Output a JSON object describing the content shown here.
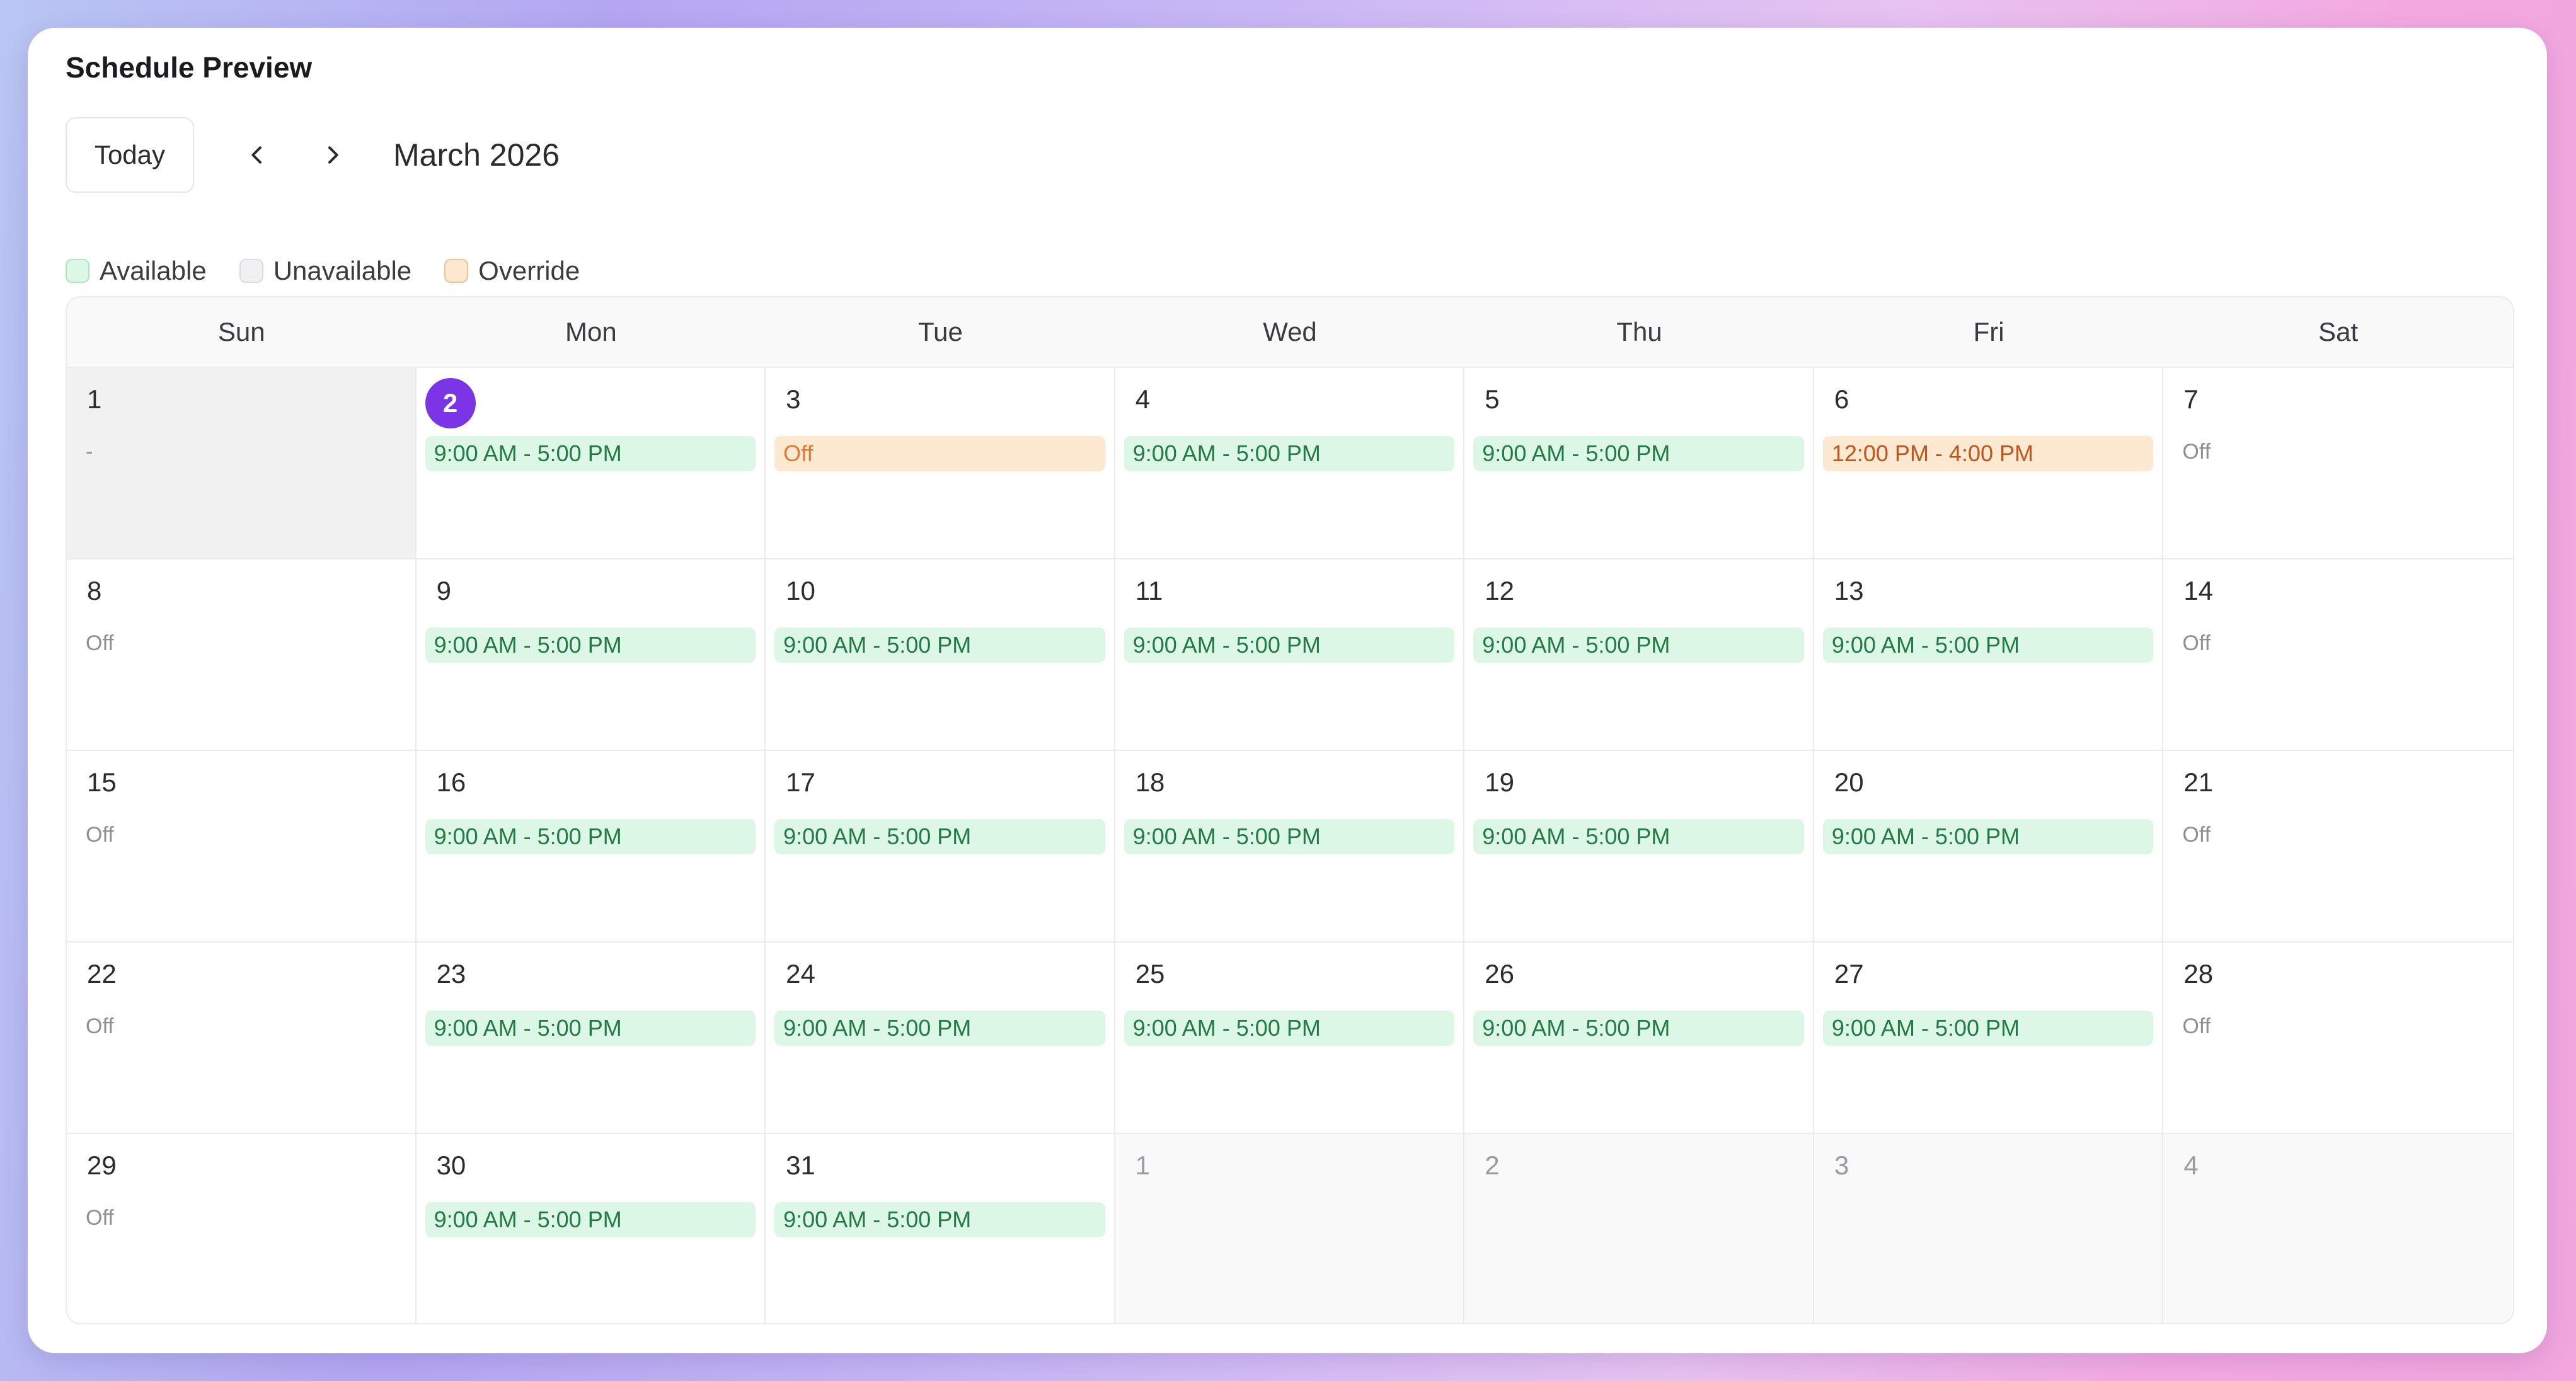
{
  "title": "Schedule Preview",
  "toolbar": {
    "today_label": "Today",
    "month_label": "March 2026"
  },
  "legend": [
    {
      "label": "Available",
      "fill": "#dcf7e6",
      "border": "#a9e7c0"
    },
    {
      "label": "Unavailable",
      "fill": "#f1f1f3",
      "border": "#dcdce0"
    },
    {
      "label": "Override",
      "fill": "#fde9d2",
      "border": "#f5c08a"
    }
  ],
  "colors": {
    "accent": "#7b35e6",
    "available_bg": "#dcf7e6",
    "available_text": "#227a47",
    "override_bg": "#fde9d2",
    "override_text": "#c0541b"
  },
  "weekdays": [
    "Sun",
    "Mon",
    "Tue",
    "Wed",
    "Thu",
    "Fri",
    "Sat"
  ],
  "days": [
    {
      "num": "1",
      "state": "past",
      "text": "-",
      "kind": "off"
    },
    {
      "num": "2",
      "state": "today",
      "text": "9:00 AM - 5:00 PM",
      "kind": "available"
    },
    {
      "num": "3",
      "state": "normal",
      "text": "Off",
      "kind": "off-override"
    },
    {
      "num": "4",
      "state": "normal",
      "text": "9:00 AM - 5:00 PM",
      "kind": "available"
    },
    {
      "num": "5",
      "state": "normal",
      "text": "9:00 AM - 5:00 PM",
      "kind": "available"
    },
    {
      "num": "6",
      "state": "normal",
      "text": "12:00 PM - 4:00 PM",
      "kind": "override"
    },
    {
      "num": "7",
      "state": "normal",
      "text": "Off",
      "kind": "off"
    },
    {
      "num": "8",
      "state": "normal",
      "text": "Off",
      "kind": "off"
    },
    {
      "num": "9",
      "state": "normal",
      "text": "9:00 AM - 5:00 PM",
      "kind": "available"
    },
    {
      "num": "10",
      "state": "normal",
      "text": "9:00 AM - 5:00 PM",
      "kind": "available"
    },
    {
      "num": "11",
      "state": "normal",
      "text": "9:00 AM - 5:00 PM",
      "kind": "available"
    },
    {
      "num": "12",
      "state": "normal",
      "text": "9:00 AM - 5:00 PM",
      "kind": "available"
    },
    {
      "num": "13",
      "state": "normal",
      "text": "9:00 AM - 5:00 PM",
      "kind": "available"
    },
    {
      "num": "14",
      "state": "normal",
      "text": "Off",
      "kind": "off"
    },
    {
      "num": "15",
      "state": "normal",
      "text": "Off",
      "kind": "off"
    },
    {
      "num": "16",
      "state": "normal",
      "text": "9:00 AM - 5:00 PM",
      "kind": "available"
    },
    {
      "num": "17",
      "state": "normal",
      "text": "9:00 AM - 5:00 PM",
      "kind": "available"
    },
    {
      "num": "18",
      "state": "normal",
      "text": "9:00 AM - 5:00 PM",
      "kind": "available"
    },
    {
      "num": "19",
      "state": "normal",
      "text": "9:00 AM - 5:00 PM",
      "kind": "available"
    },
    {
      "num": "20",
      "state": "normal",
      "text": "9:00 AM - 5:00 PM",
      "kind": "available"
    },
    {
      "num": "21",
      "state": "normal",
      "text": "Off",
      "kind": "off"
    },
    {
      "num": "22",
      "state": "normal",
      "text": "Off",
      "kind": "off"
    },
    {
      "num": "23",
      "state": "normal",
      "text": "9:00 AM - 5:00 PM",
      "kind": "available"
    },
    {
      "num": "24",
      "state": "normal",
      "text": "9:00 AM - 5:00 PM",
      "kind": "available"
    },
    {
      "num": "25",
      "state": "normal",
      "text": "9:00 AM - 5:00 PM",
      "kind": "available"
    },
    {
      "num": "26",
      "state": "normal",
      "text": "9:00 AM - 5:00 PM",
      "kind": "available"
    },
    {
      "num": "27",
      "state": "normal",
      "text": "9:00 AM - 5:00 PM",
      "kind": "available"
    },
    {
      "num": "28",
      "state": "normal",
      "text": "Off",
      "kind": "off"
    },
    {
      "num": "29",
      "state": "normal",
      "text": "Off",
      "kind": "off"
    },
    {
      "num": "30",
      "state": "normal",
      "text": "9:00 AM - 5:00 PM",
      "kind": "available"
    },
    {
      "num": "31",
      "state": "normal",
      "text": "9:00 AM - 5:00 PM",
      "kind": "available"
    },
    {
      "num": "1",
      "state": "outside",
      "text": "",
      "kind": "none"
    },
    {
      "num": "2",
      "state": "outside",
      "text": "",
      "kind": "none"
    },
    {
      "num": "3",
      "state": "outside",
      "text": "",
      "kind": "none"
    },
    {
      "num": "4",
      "state": "outside",
      "text": "",
      "kind": "none"
    }
  ]
}
